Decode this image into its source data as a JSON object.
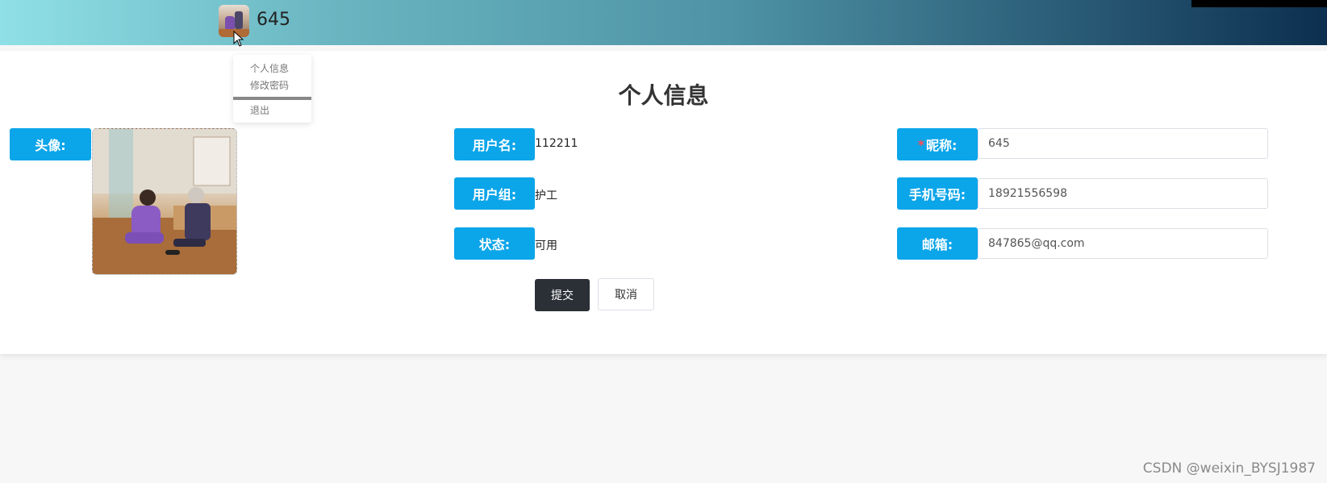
{
  "header": {
    "username": "645"
  },
  "dropdown": {
    "items": [
      "个人信息",
      "修改密码",
      "退出"
    ]
  },
  "page": {
    "title": "个人信息"
  },
  "form": {
    "avatar_label": "头像:",
    "username_label": "用户名:",
    "username_value": "112211",
    "group_label": "用户组:",
    "group_value": "护工",
    "status_label": "状态:",
    "status_value": "可用",
    "nickname_required": "*",
    "nickname_label": "昵称:",
    "nickname_value": "645",
    "phone_label": "手机号码:",
    "phone_value": "18921556598",
    "email_label": "邮箱:",
    "email_value": "847865@qq.com",
    "submit_label": "提交",
    "cancel_label": "取消"
  },
  "watermark": "CSDN @weixin_BYSJ1987",
  "colors": {
    "label_bg": "#0ba5e9",
    "primary_btn": "#2b2f36",
    "required": "#ff4d4f"
  }
}
